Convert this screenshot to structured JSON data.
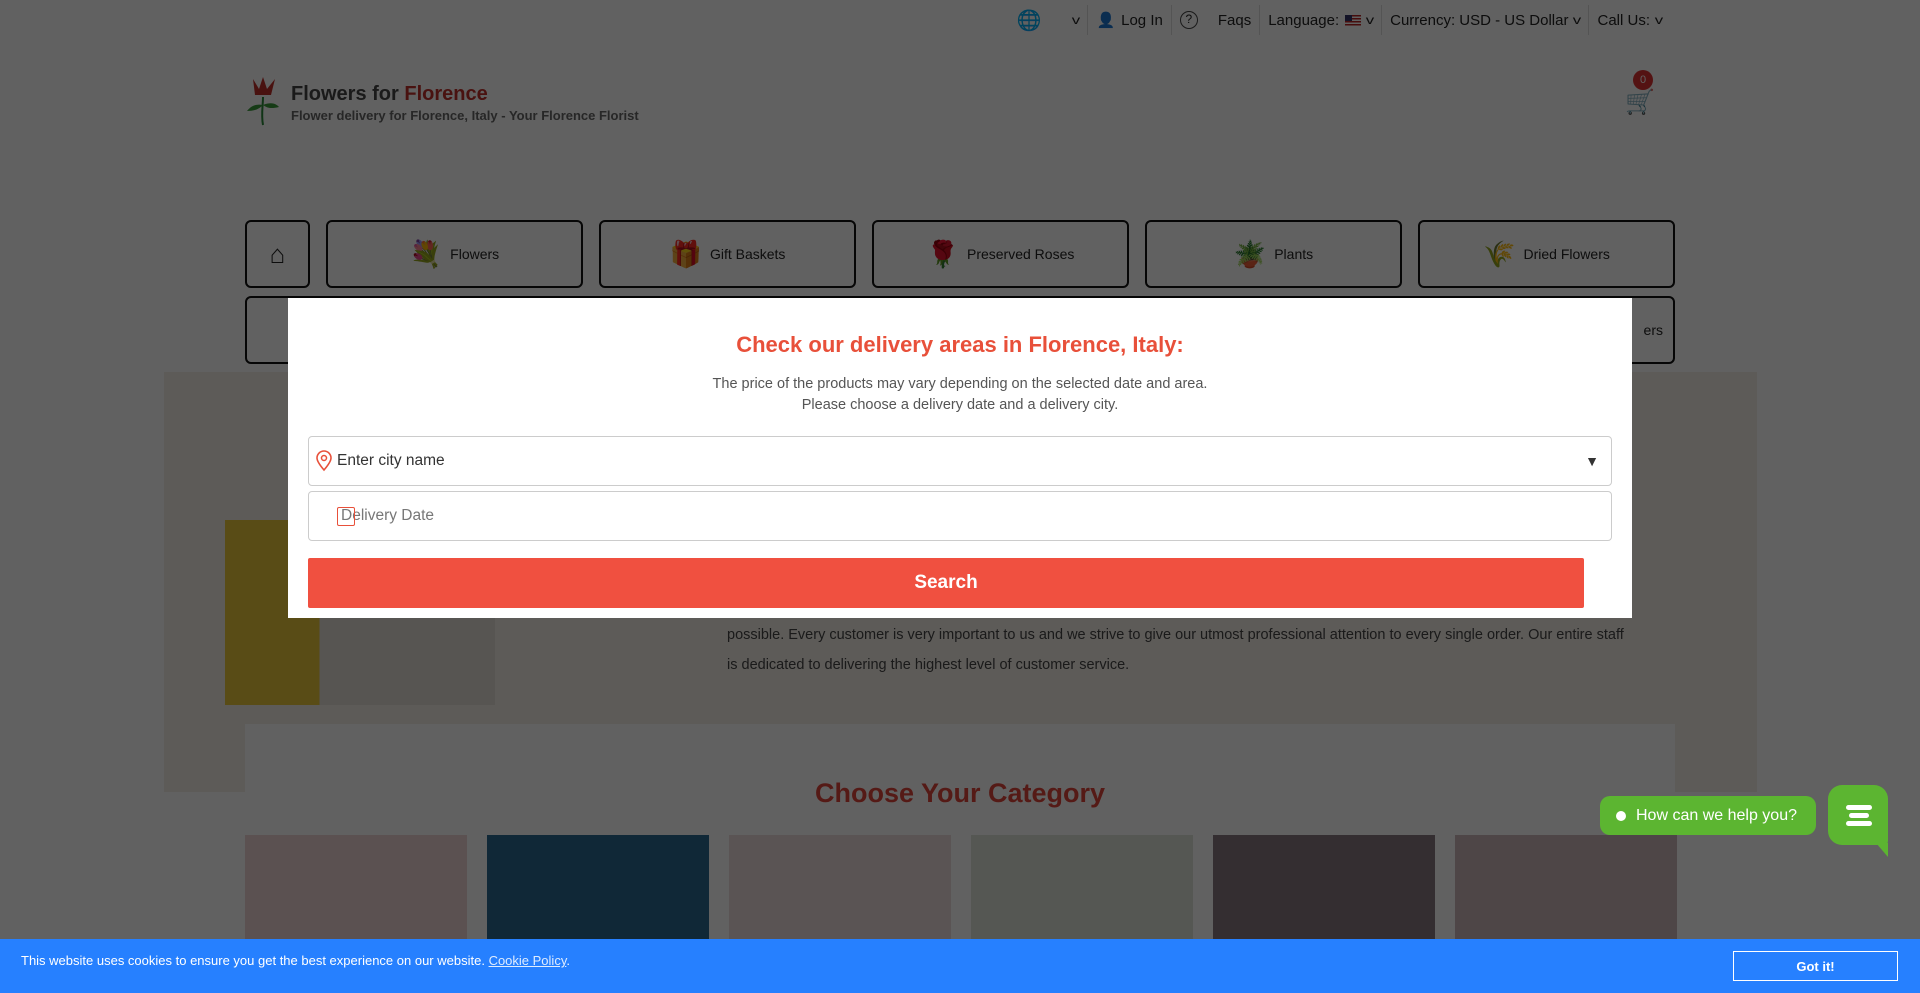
{
  "topbar": {
    "login": "Log In",
    "faqs": "Faqs",
    "language": "Language:",
    "currency": "Currency: USD - US Dollar",
    "call": "Call Us:"
  },
  "logo": {
    "name_a": "Flowers for ",
    "name_b": "Florence",
    "tagline": "Flower delivery for Florence, Italy - Your Florence Florist"
  },
  "cart": {
    "count": "0"
  },
  "nav": [
    {
      "label": "Flowers",
      "icon": "bouquet-icon"
    },
    {
      "label": "Gift Baskets",
      "icon": "gift-icon"
    },
    {
      "label": "Preserved Roses",
      "icon": "rose-dome-icon"
    },
    {
      "label": "Plants",
      "icon": "plant-icon"
    },
    {
      "label": "Dried Flowers",
      "icon": "dried-flowers-icon"
    }
  ],
  "nav_row2_partial": "ers",
  "background": {
    "line1": "possible. Every customer is very important to us and we strive to give our utmost professional attention to every single order. Our entire staff",
    "line2": "is dedicated to delivering the highest level of customer service.",
    "category_title": "Choose Your Category"
  },
  "modal": {
    "title": "Check our delivery areas in Florence, Italy:",
    "line1": "The price of the products may vary depending on the selected date and area.",
    "line2": "Please choose a delivery date and a delivery city.",
    "city_placeholder": "Enter city name",
    "date_placeholder": "Delivery Date",
    "search": "Search"
  },
  "cookie": {
    "text": "This website uses cookies to ensure you get the best experience on our website.",
    "link": "Cookie Policy",
    "button": "Got it!"
  },
  "chat": {
    "label": "How can we help you?"
  },
  "colors": {
    "accent": "#f05040",
    "cookie": "#2680ff",
    "chat": "#5cb531"
  }
}
